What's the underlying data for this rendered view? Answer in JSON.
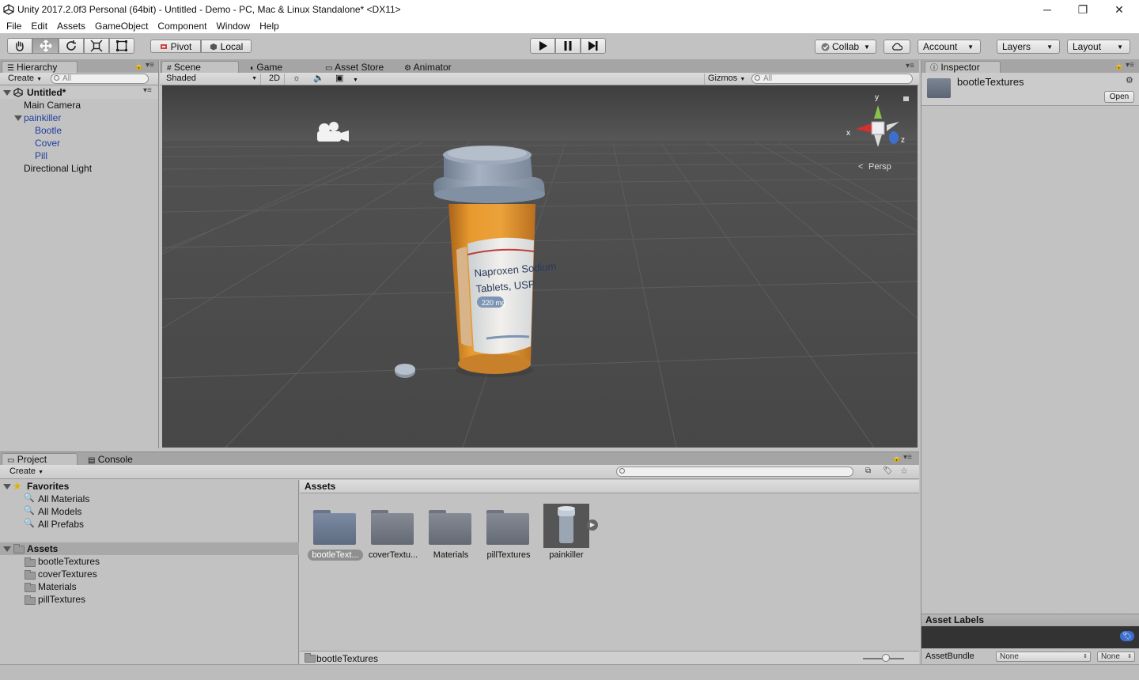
{
  "window": {
    "title": "Unity 2017.2.0f3 Personal (64bit) - Untitled - Demo - PC, Mac & Linux Standalone* <DX11>",
    "minimize": "─",
    "restore": "❐",
    "close": "✕"
  },
  "menu": [
    "File",
    "Edit",
    "Assets",
    "GameObject",
    "Component",
    "Window",
    "Help"
  ],
  "toolbar": {
    "pivot": "Pivot",
    "local": "Local",
    "collab": "Collab",
    "account": "Account",
    "layers": "Layers",
    "layout": "Layout"
  },
  "hierarchy": {
    "tab": "Hierarchy",
    "create": "Create",
    "search_placeholder": "All",
    "scene": "Untitled*",
    "items": [
      "Main Camera",
      "painkiller",
      "Bootle",
      "Cover",
      "Pill",
      "Directional Light"
    ]
  },
  "scene": {
    "tabs": [
      "Scene",
      "Game",
      "Asset Store",
      "Animator"
    ],
    "shading": "Shaded",
    "mode_2d": "2D",
    "gizmos": "Gizmos",
    "search_placeholder": "All",
    "projection": "Persp",
    "axis_x": "x",
    "axis_y": "y",
    "axis_z": "z",
    "label_lines": [
      "Naproxen Sodium",
      "Tablets, USP"
    ],
    "label_dose": "220 mg"
  },
  "project": {
    "tabs": [
      "Project",
      "Console"
    ],
    "create": "Create",
    "favorites_title": "Favorites",
    "favorites": [
      "All Materials",
      "All Models",
      "All Prefabs"
    ],
    "assets_root": "Assets",
    "asset_folders": [
      "bootleTextures",
      "coverTextures",
      "Materials",
      "pillTextures"
    ],
    "breadcrumb": "Assets",
    "tiles": [
      "bootleText...",
      "coverTextu...",
      "Materials",
      "pillTextures",
      "painkiller"
    ],
    "status_path": "bootleTextures"
  },
  "inspector": {
    "tab": "Inspector",
    "title": "bootleTextures",
    "open": "Open",
    "asset_labels": "Asset Labels",
    "assetbundle_label": "AssetBundle",
    "assetbundle_value": "None",
    "variant_value": "None"
  },
  "colors": {
    "selection_blue": "#3d6fcf",
    "prefab_blue": "#1f3f9f",
    "scene_bg": "#474747",
    "bottle_orange": "#e89a2e",
    "cap_blue": "#8f9fb3"
  }
}
